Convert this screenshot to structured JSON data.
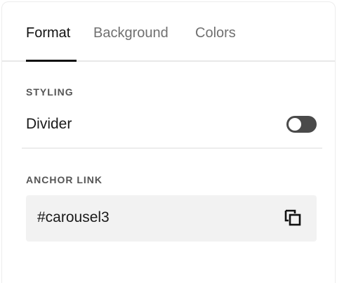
{
  "tabs": [
    {
      "label": "Format",
      "active": true
    },
    {
      "label": "Background",
      "active": false
    },
    {
      "label": "Colors",
      "active": false
    }
  ],
  "styling": {
    "section_label": "STYLING",
    "divider_label": "Divider",
    "divider_enabled": false
  },
  "anchor": {
    "section_label": "ANCHOR LINK",
    "value": "#carousel3",
    "copy_icon": "copy-icon"
  },
  "colors": {
    "active_text": "#111111",
    "inactive_text": "#707070",
    "toggle_track": "#4a4a4a",
    "field_bg": "#f2f2f2"
  }
}
